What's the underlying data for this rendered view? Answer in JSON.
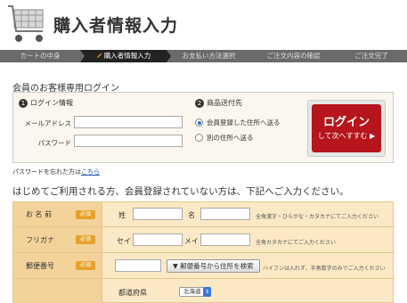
{
  "header": {
    "title": "購入者情報入力"
  },
  "steps": [
    "カートの中身",
    "購入者情報入力",
    "お支払い方法選択",
    "ご注文内容の確認",
    "ご注文完了"
  ],
  "member": {
    "title": "会員のお客様専用ログイン",
    "login_section": {
      "number": "1",
      "title": "ログイン情報",
      "email_label": "メールアドレス",
      "password_label": "パスワード",
      "email_value": "",
      "password_value": ""
    },
    "shipping_section": {
      "number": "2",
      "title": "商品送付先",
      "option_registered": "会員登録した住所へ送る",
      "option_other": "別の住所へ送る"
    },
    "login_button": {
      "line1": "ログイン",
      "line2": "して次へすすむ"
    }
  },
  "forgot": {
    "text": "パスワードを忘れた方は",
    "link": "こちら"
  },
  "guest_title": "はじめてご利用される方、会員登録されていない方は、下記へご入力ください。",
  "form": {
    "required": "必須",
    "name": {
      "label": "お 名 前",
      "sei": "姓",
      "mei": "名",
      "hint": "全角漢字・ひらがな・カタカナにてご入力ください"
    },
    "furigana": {
      "label": "フリガナ",
      "sei": "セイ",
      "mei": "メイ",
      "hint": "全角カタカナにてご入力ください"
    },
    "postal": {
      "label": "郵便番号",
      "button": "郵便番号から住所を検索",
      "hint": "ハイフンは入れず、半角数字のみでご入力ください"
    },
    "prefecture": {
      "label": "都道府県",
      "selected": "北海道"
    }
  },
  "colors": {
    "accent_red": "#b5151b",
    "required_orange": "#e8a128",
    "form_bg": "#fbe9c6"
  }
}
